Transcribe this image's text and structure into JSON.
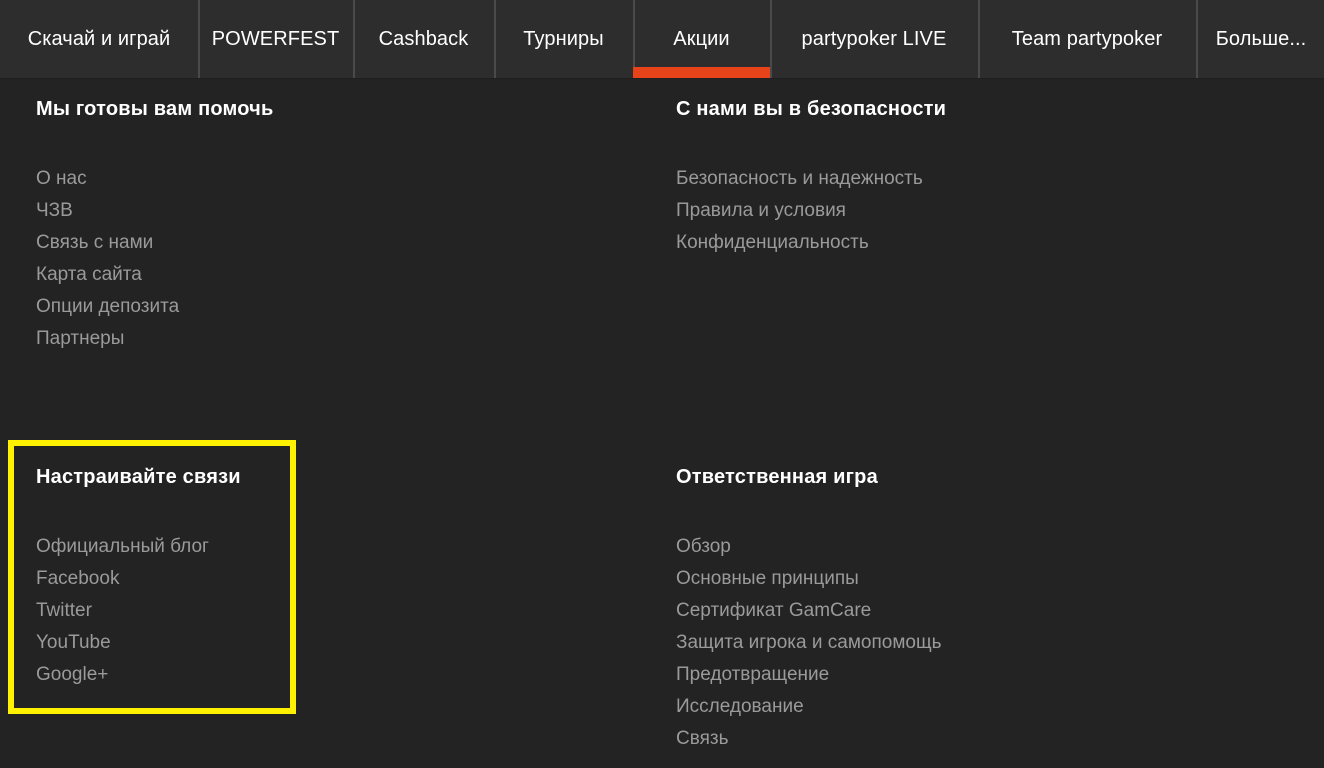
{
  "colors": {
    "page_background": "#232323",
    "nav_background": "#2d2d2d",
    "nav_separator": "#4a4a4a",
    "active_accent": "#e6431a",
    "heading_text": "#ffffff",
    "link_text": "#9a9a9a",
    "highlight_border": "#fff100"
  },
  "nav": {
    "items": [
      {
        "label": "Скачай и играй",
        "active": false
      },
      {
        "label": "POWERFEST",
        "active": false
      },
      {
        "label": "Cashback",
        "active": false
      },
      {
        "label": "Турниры",
        "active": false
      },
      {
        "label": "Акции",
        "active": true
      },
      {
        "label": "partypoker LIVE",
        "active": false
      },
      {
        "label": "Team partypoker",
        "active": false
      },
      {
        "label": "Больше...",
        "active": false
      }
    ]
  },
  "footer": {
    "columns": [
      {
        "id": "help",
        "heading": "Мы готовы вам помочь",
        "links": [
          "О нас",
          "ЧЗВ",
          "Связь с нами",
          "Карта сайта",
          "Опции депозита",
          "Партнеры"
        ]
      },
      {
        "id": "security",
        "heading": "С нами вы в безопасности",
        "links": [
          "Безопасность и надежность",
          "Правила и условия",
          "Конфиденциальность"
        ]
      },
      {
        "id": "social",
        "heading": "Настраивайте связи",
        "links": [
          "Официальный блог",
          "Facebook",
          "Twitter",
          "YouTube",
          "Google+"
        ]
      },
      {
        "id": "responsible",
        "heading": "Ответственная игра",
        "links": [
          "Обзор",
          "Основные принципы",
          "Сертификат GamCare",
          "Защита игрока и самопомощь",
          "Предотвращение",
          "Исследование",
          "Связь"
        ]
      }
    ]
  },
  "annotation": {
    "highlight_target": "social"
  }
}
